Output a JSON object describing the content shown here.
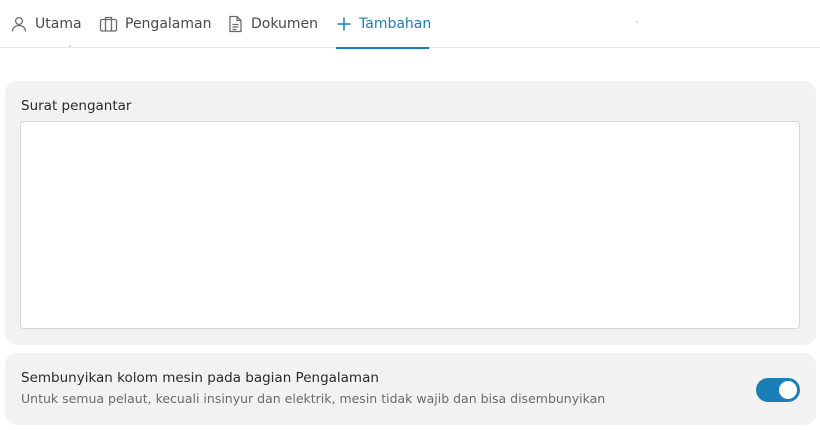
{
  "tabs": [
    {
      "label": "Utama",
      "icon": "person-icon"
    },
    {
      "label": "Pengalaman",
      "icon": "briefcase-icon"
    },
    {
      "label": "Dokumen",
      "icon": "document-icon"
    },
    {
      "label": "Tambahan",
      "icon": "plus-icon",
      "active": true
    }
  ],
  "cover_letter": {
    "label": "Surat pengantar",
    "value": ""
  },
  "hide_engine": {
    "title": "Sembunyikan kolom mesin pada bagian Pengalaman",
    "description": "Untuk semua pelaut, kecuali insinyur dan elektrik, mesin tidak wajib dan bisa disembunyikan",
    "enabled": true
  },
  "colors": {
    "accent": "#1a7fb8",
    "card_bg": "#f3f2f2",
    "text_muted": "#6b6b6b"
  }
}
